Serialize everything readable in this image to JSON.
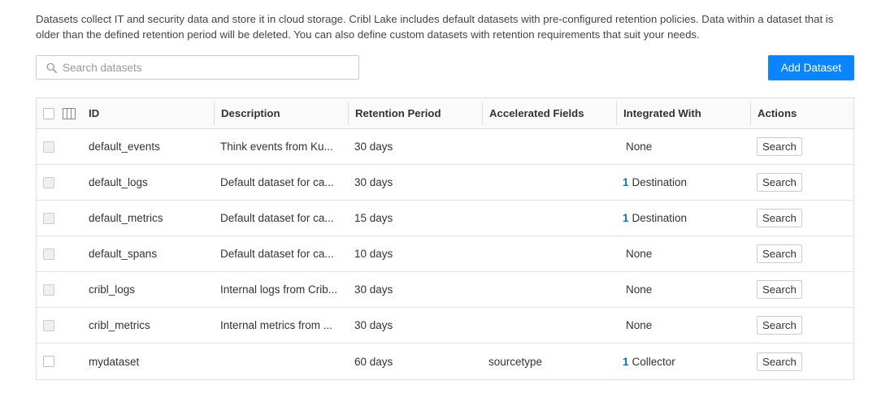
{
  "description": "Datasets collect IT and security data and store it in cloud storage. Cribl Lake includes default datasets with pre-configured retention policies. Data within a dataset that is older than the defined retention period will be deleted. You can also define custom datasets with retention requirements that suit your needs.",
  "search": {
    "placeholder": "Search datasets",
    "value": ""
  },
  "add_button_label": "Add Dataset",
  "columns": {
    "id": "ID",
    "description": "Description",
    "retention": "Retention Period",
    "accelerated": "Accelerated Fields",
    "integrated": "Integrated With",
    "actions": "Actions"
  },
  "rows": [
    {
      "id": "default_events",
      "description": "Think events from Ku...",
      "retention": "30 days",
      "accelerated": "",
      "integrated_count": "",
      "integrated_label": "None",
      "action": "Search"
    },
    {
      "id": "default_logs",
      "description": "Default dataset for ca...",
      "retention": "30 days",
      "accelerated": "",
      "integrated_count": "1",
      "integrated_label": "Destination",
      "action": "Search"
    },
    {
      "id": "default_metrics",
      "description": "Default dataset for ca...",
      "retention": "15 days",
      "accelerated": "",
      "integrated_count": "1",
      "integrated_label": "Destination",
      "action": "Search"
    },
    {
      "id": "default_spans",
      "description": "Default dataset for ca...",
      "retention": "10 days",
      "accelerated": "",
      "integrated_count": "",
      "integrated_label": "None",
      "action": "Search"
    },
    {
      "id": "cribl_logs",
      "description": "Internal logs from Crib...",
      "retention": "30 days",
      "accelerated": "",
      "integrated_count": "",
      "integrated_label": "None",
      "action": "Search"
    },
    {
      "id": "cribl_metrics",
      "description": "Internal metrics from ...",
      "retention": "30 days",
      "accelerated": "",
      "integrated_count": "",
      "integrated_label": "None",
      "action": "Search"
    },
    {
      "id": "mydataset",
      "description": "",
      "retention": "60 days",
      "accelerated": "sourcetype",
      "integrated_count": "1",
      "integrated_label": "Collector",
      "action": "Search"
    }
  ],
  "colors": {
    "accent": "#0a84ff",
    "link": "#0a6fd6"
  },
  "icons": {
    "search": "search-icon",
    "columns": "columns-icon"
  }
}
